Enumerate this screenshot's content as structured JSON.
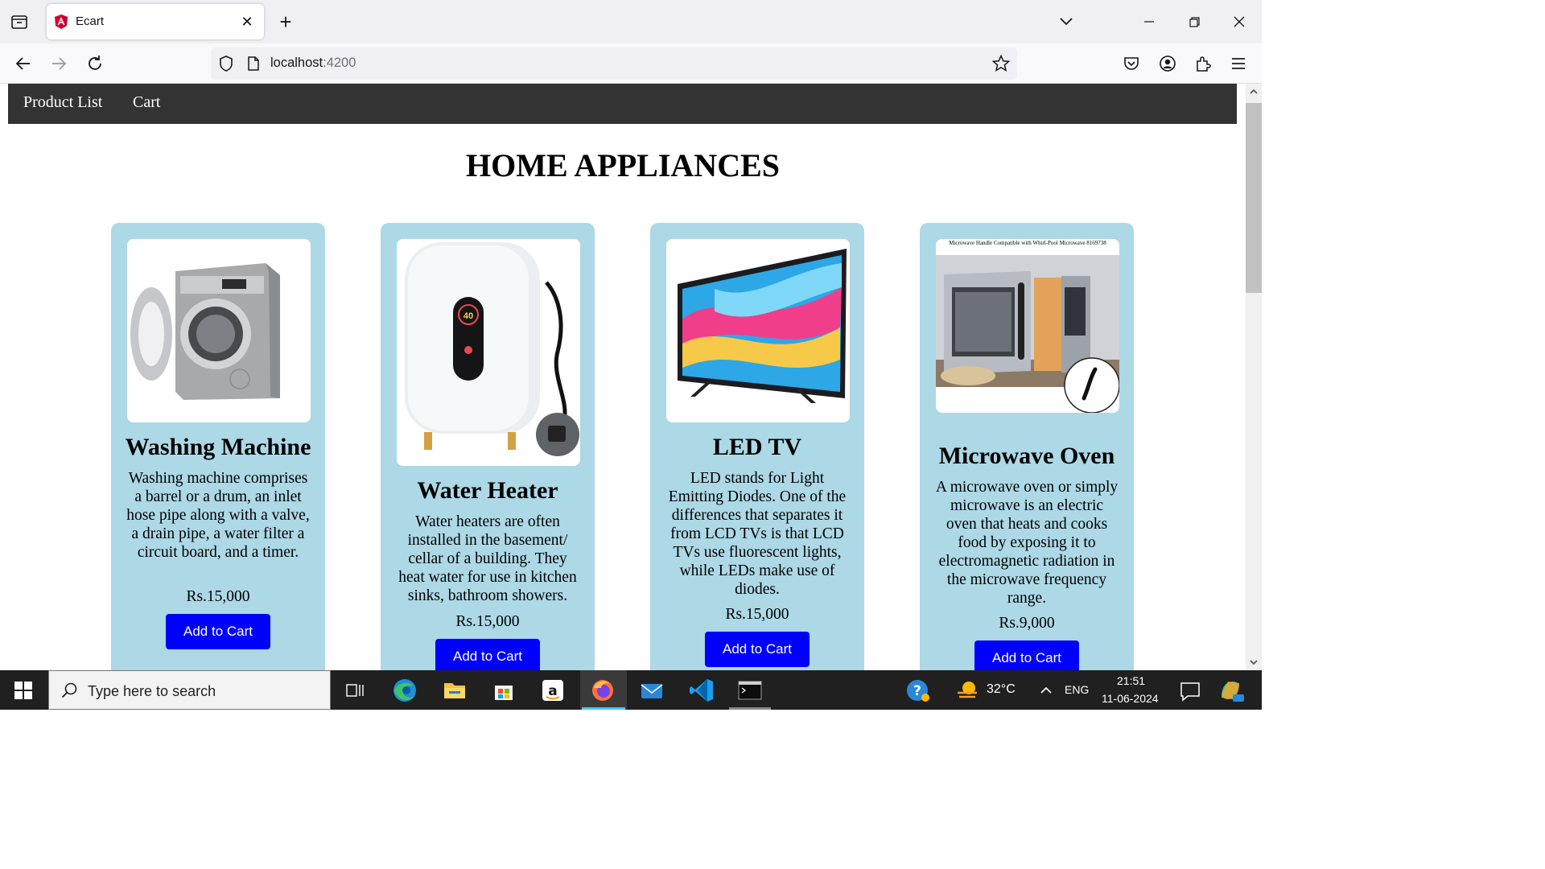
{
  "browser": {
    "tab_title": "Ecart",
    "url_host": "localhost",
    "url_port": ":4200"
  },
  "site": {
    "nav": [
      "Product List",
      "Cart"
    ],
    "heading": "HOME APPLIANCES",
    "products": [
      {
        "name": "Washing Machine",
        "description": "Washing machine comprises a barrel or a drum, an inlet hose pipe along with a valve, a drain pipe, a water filter a circuit board, and a timer.",
        "price": "Rs.15,000",
        "button": "Add to Cart"
      },
      {
        "name": "Water Heater",
        "description": "Water heaters are often installed in the basement/ cellar of a building. They heat water for use in kitchen sinks, bathroom showers.",
        "price": "Rs.15,000",
        "button": "Add to Cart",
        "image_text": "40"
      },
      {
        "name": "LED TV",
        "description": "LED stands for Light Emitting Diodes. One of the differences that separates it from LCD TVs is that LCD TVs use fluorescent lights, while LEDs make use of diodes.",
        "price": "Rs.15,000",
        "button": "Add to Cart"
      },
      {
        "name": "Microwave Oven",
        "description": "A microwave oven or simply microwave is an electric oven that heats and cooks food by exposing it to electromagnetic radiation in the microwave frequency range.",
        "price": "Rs.9,000",
        "button": "Add to Cart",
        "image_caption": "Microwave Handle Compatible with Whirl-Pool Microwave 8169738"
      }
    ]
  },
  "taskbar": {
    "search_placeholder": "Type here to search",
    "temperature": "32°C",
    "language": "ENG",
    "time": "21:51",
    "date": "11-06-2024"
  },
  "colors": {
    "card_bg": "#add8e6",
    "button_bg": "#0000ff",
    "site_nav_bg": "#333333"
  }
}
